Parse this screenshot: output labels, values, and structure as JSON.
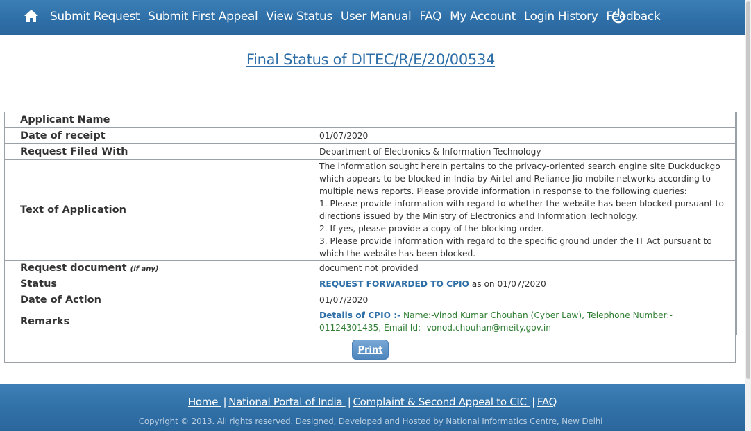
{
  "nav": {
    "items": [
      {
        "label": "Submit Request"
      },
      {
        "label": "Submit First Appeal"
      },
      {
        "label": "View Status"
      },
      {
        "label": "User Manual"
      },
      {
        "label": "FAQ"
      },
      {
        "label": "My Account"
      },
      {
        "label": "Login History"
      },
      {
        "label": "Feedback"
      }
    ],
    "icons": {
      "home": "home-icon",
      "logout": "power-icon"
    }
  },
  "page": {
    "title": "Final Status of   DITEC/R/E/20/00534"
  },
  "details": {
    "applicant_name_label": "Applicant Name",
    "applicant_name_value": "",
    "date_of_receipt_label": "Date of receipt",
    "date_of_receipt_value": "01/07/2020",
    "filed_with_label": "Request Filed With",
    "filed_with_value": "Department of Electronics & Information Technology",
    "text_label": "Text of Application",
    "text_value_lines": [
      "The information sought herein pertains to the privacy-oriented search engine site Duckduckgo which appears to be blocked in India by Airtel and Reliance Jio mobile networks according to multiple news reports. Please provide information in response to the following queries:",
      "1. Please provide information with regard to whether the website has been blocked pursuant to directions issued by the Ministry of Electronics and Information Technology.",
      "2. If yes, please provide a copy of the blocking order.",
      "3. Please provide information with regard to the specific ground under the IT Act pursuant to which the website has been blocked."
    ],
    "request_doc_label": "Request document",
    "request_doc_hint": "(if any)",
    "request_doc_value": "document not provided",
    "status_label": "Status",
    "status_strong": "REQUEST FORWARDED TO CPIO",
    "status_suffix": " as on 01/07/2020",
    "date_action_label": "Date of Action",
    "date_action_value": "01/07/2020",
    "remarks_label": "Remarks",
    "remarks_cpio_label": "Details of CPIO :-",
    "remarks_cpio_text": " Name:-Vinod Kumar Chouhan (Cyber Law), Telephone Number:- 01124301435, Email Id:- vonod.chouhan@meity.gov.in"
  },
  "actions": {
    "print_label": "Print"
  },
  "footer": {
    "links": [
      {
        "label": "Home "
      },
      {
        "label": "National Portal of India "
      },
      {
        "label": "Complaint & Second Appeal to CIC "
      },
      {
        "label": "FAQ"
      }
    ],
    "separator": "|",
    "copyright": "Copyright © 2013. All rights reserved. Designed, Developed and Hosted by National Informatics Centre, New Delhi"
  },
  "colors": {
    "header_blue": "#2e6ea6",
    "link_blue": "#2f6fa8",
    "cpio_green": "#2e7d32"
  }
}
